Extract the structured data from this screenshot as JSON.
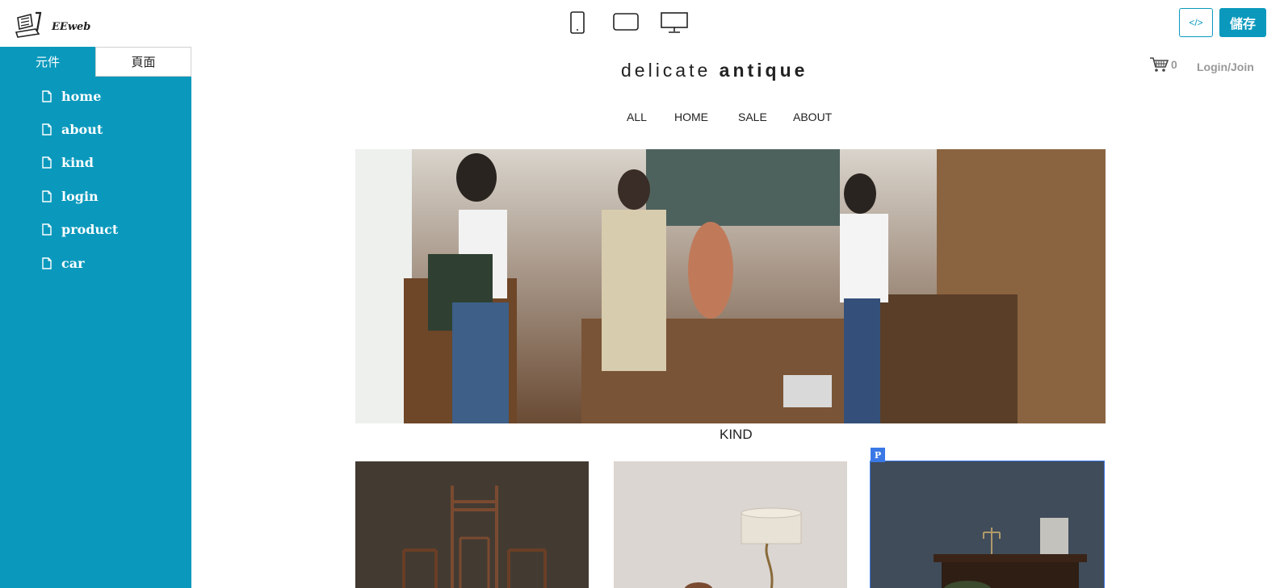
{
  "topbar": {
    "logo_text": "EEweb",
    "devices": [
      "mobile-icon",
      "tablet-icon",
      "desktop-icon"
    ],
    "code_button_label": "</>",
    "save_button_label": "儲存"
  },
  "sidebar": {
    "tabs": [
      {
        "label": "元件",
        "active": true
      },
      {
        "label": "頁面",
        "active": false
      }
    ],
    "pages": [
      {
        "label": "home"
      },
      {
        "label": "about"
      },
      {
        "label": "kind"
      },
      {
        "label": "login"
      },
      {
        "label": "product"
      },
      {
        "label": "car"
      }
    ]
  },
  "site": {
    "brand_light": "delicate",
    "brand_bold": "antique",
    "cart_count": "0",
    "login_label": "Login/Join",
    "menu": [
      "ALL",
      "HOME",
      "SALE",
      "ABOUT"
    ],
    "section_title": "KIND",
    "selected_badge": "P"
  },
  "colors": {
    "accent": "#0a99bd",
    "selection": "#3a78e6"
  }
}
